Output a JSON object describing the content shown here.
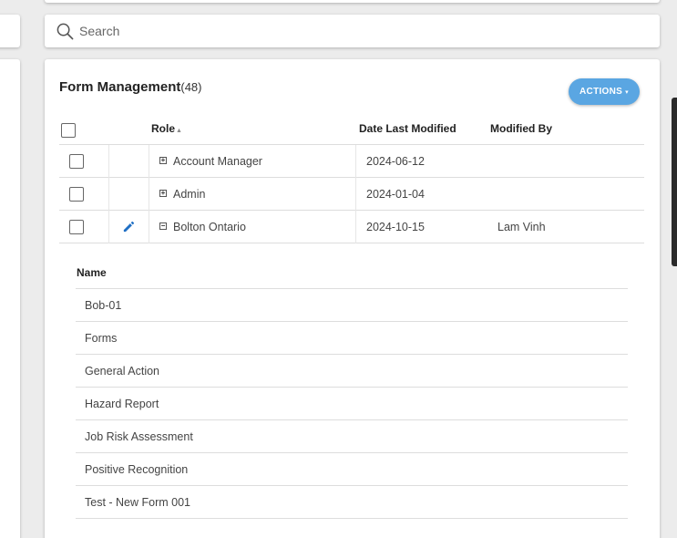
{
  "search": {
    "placeholder": "Search",
    "value": ""
  },
  "card": {
    "title": "Form Management",
    "count": "(48)",
    "actions_label": "ACTIONS"
  },
  "table": {
    "columns": {
      "role": "Role",
      "date": "Date Last Modified",
      "modified_by": "Modified By"
    },
    "rows": [
      {
        "role": "Account Manager",
        "date": "2024-06-12",
        "modified_by": "",
        "expanded": false
      },
      {
        "role": "Admin",
        "date": "2024-01-04",
        "modified_by": "",
        "expanded": false
      },
      {
        "role": "Bolton Ontario",
        "date": "2024-10-15",
        "modified_by": "Lam Vinh",
        "expanded": true
      }
    ]
  },
  "subtable": {
    "header": "Name",
    "rows": [
      "Bob-01",
      "Forms",
      "General Action",
      "Hazard Report",
      "Job Risk Assessment",
      "Positive Recognition",
      "Test - New Form 001"
    ]
  },
  "icons": {
    "search": "search-icon",
    "edit": "pencil-icon",
    "expand": "plus-box-icon",
    "collapse": "minus-box-icon",
    "sort": "sort-asc-icon",
    "caret": "caret-down-icon"
  },
  "colors": {
    "accent": "#5aa6e2",
    "edit_icon": "#1f6fc4"
  }
}
